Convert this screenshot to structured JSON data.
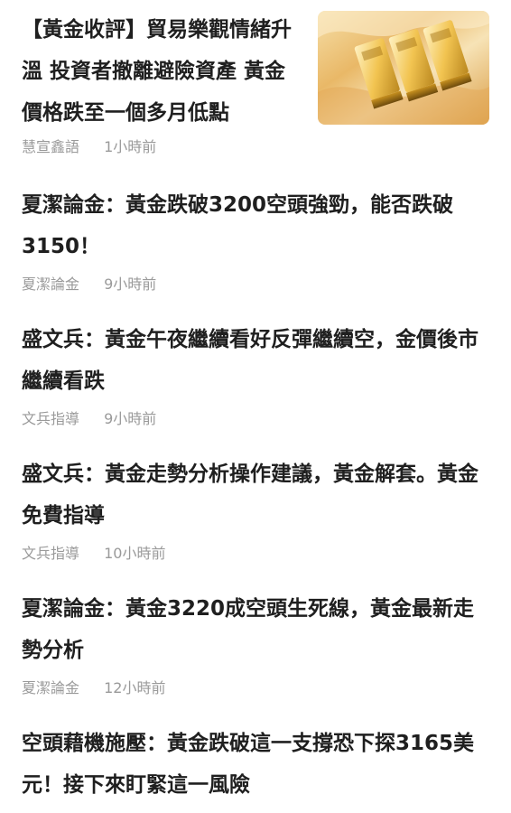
{
  "articles": [
    {
      "title": "【黃金收評】貿易樂觀情緒升溫 投資者撤離避險資產 黃金價格跌至一個多月低點",
      "source": "慧宣鑫語",
      "time": "1小時前",
      "has_thumbnail": true,
      "thumbnail_icon": "gold-bars-image"
    },
    {
      "title": "夏潔論金：黃金跌破3200空頭強勁，能否跌破3150！",
      "source": "夏潔論金",
      "time": "9小時前"
    },
    {
      "title": "盛文兵：黃金午夜繼續看好反彈繼續空，金價後市繼續看跌",
      "source": "文兵指導",
      "time": "9小時前"
    },
    {
      "title": "盛文兵：黃金走勢分析操作建議，黃金解套。黃金免費指導",
      "source": "文兵指導",
      "time": "10小時前"
    },
    {
      "title": "夏潔論金：黃金3220成空頭生死線，黃金最新走勢分析",
      "source": "夏潔論金",
      "time": "12小時前"
    },
    {
      "title": "空頭藉機施壓：黃金跌破這一支撐恐下探3165美元！接下來盯緊這一風險",
      "source": "",
      "time": ""
    }
  ],
  "colors": {
    "title": "#1f1f1f",
    "meta": "#9a9a9a",
    "background": "#ffffff"
  }
}
